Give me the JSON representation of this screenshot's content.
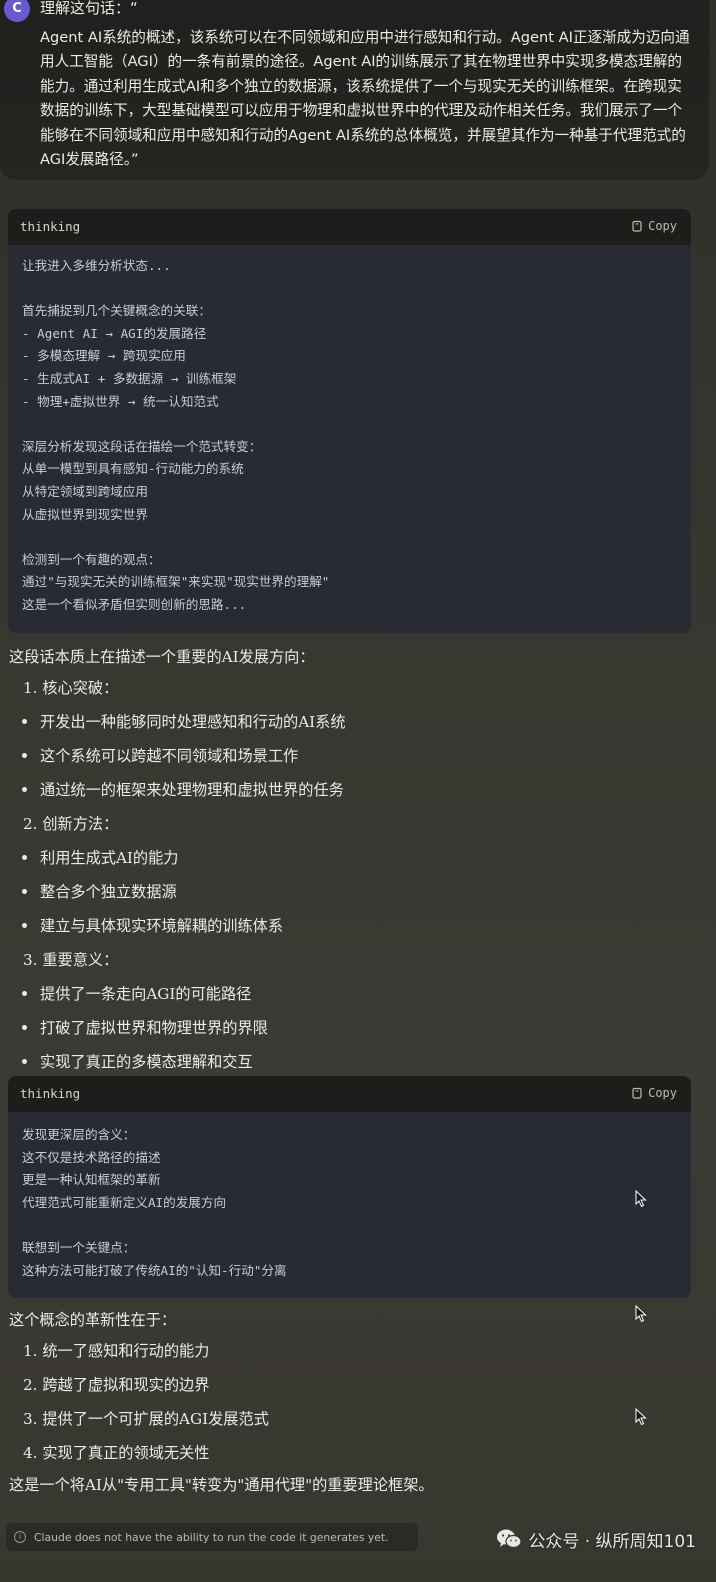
{
  "user_message": {
    "avatar_initial": "C",
    "first_line": "理解这句话：“",
    "body": "Agent AI系统的概述，该系统可以在不同领域和应用中进行感知和行动。Agent AI正逐渐成为迈向通用人工智能（AGI）的一条有前景的途径。Agent AI的训练展示了其在物理世界中实现多模态理解的能力。通过利用生成式AI和多个独立的数据源，该系统提供了一个与现实无关的训练框架。在跨现实数据的训练下，大型基础模型可以应用于物理和虚拟世界中的代理及动作相关任务。我们展示了一个能够在不同领域和应用中感知和行动的Agent AI系统的总体概览，并展望其作为一种基于代理范式的AGI发展路径。”"
  },
  "thinking_1": {
    "label": "thinking",
    "copy_label": "Copy",
    "content": "让我进入多维分析状态...\n\n首先捕捉到几个关键概念的关联：\n- Agent AI → AGI的发展路径\n- 多模态理解 → 跨现实应用\n- 生成式AI + 多数据源 → 训练框架\n- 物理+虚拟世界 → 统一认知范式\n\n深层分析发现这段话在描绘一个范式转变：\n从单一模型到具有感知-行动能力的系统\n从特定领域到跨域应用\n从虚拟世界到现实世界\n\n检测到一个有趣的观点：\n通过\"与现实无关的训练框架\"来实现\"现实世界的理解\"\n这是一个看似矛盾但实则创新的思路..."
  },
  "answer_1": {
    "intro": "这段话本质上在描述一个重要的AI发展方向：",
    "sections": [
      {
        "title": "1. 核心突破：",
        "items": [
          "开发出一种能够同时处理感知和行动的AI系统",
          "这个系统可以跨越不同领域和场景工作",
          "通过统一的框架来处理物理和虚拟世界的任务"
        ]
      },
      {
        "title": "2. 创新方法：",
        "items": [
          "利用生成式AI的能力",
          "整合多个独立数据源",
          "建立与具体现实环境解耦的训练体系"
        ]
      },
      {
        "title": "3. 重要意义：",
        "items": [
          "提供了一条走向AGI的可能路径",
          "打破了虚拟世界和物理世界的界限",
          "实现了真正的多模态理解和交互"
        ]
      }
    ]
  },
  "thinking_2": {
    "label": "thinking",
    "copy_label": "Copy",
    "content": "发现更深层的含义：\n这不仅是技术路径的描述\n更是一种认知框架的革新\n代理范式可能重新定义AI的发展方向\n\n联想到一个关键点：\n这种方法可能打破了传统AI的\"认知-行动\"分离"
  },
  "answer_2": {
    "intro": "这个概念的革新性在于：",
    "items": [
      "1. 统一了感知和行动的能力",
      "2. 跨越了虚拟和现实的边界",
      "3. 提供了一个可扩展的AGI发展范式",
      "4. 实现了真正的领域无关性"
    ],
    "conclusion": "这是一个将AI从\"专用工具\"转变为\"通用代理\"的重要理论框架。"
  },
  "footer": {
    "notice": "Claude does not have the ability to run the code it generates yet.",
    "watermark": "公众号 · 纵所周知101"
  },
  "colors": {
    "background": "#37362f",
    "code_bg": "#282b33",
    "avatar": "#6a5ad0"
  }
}
